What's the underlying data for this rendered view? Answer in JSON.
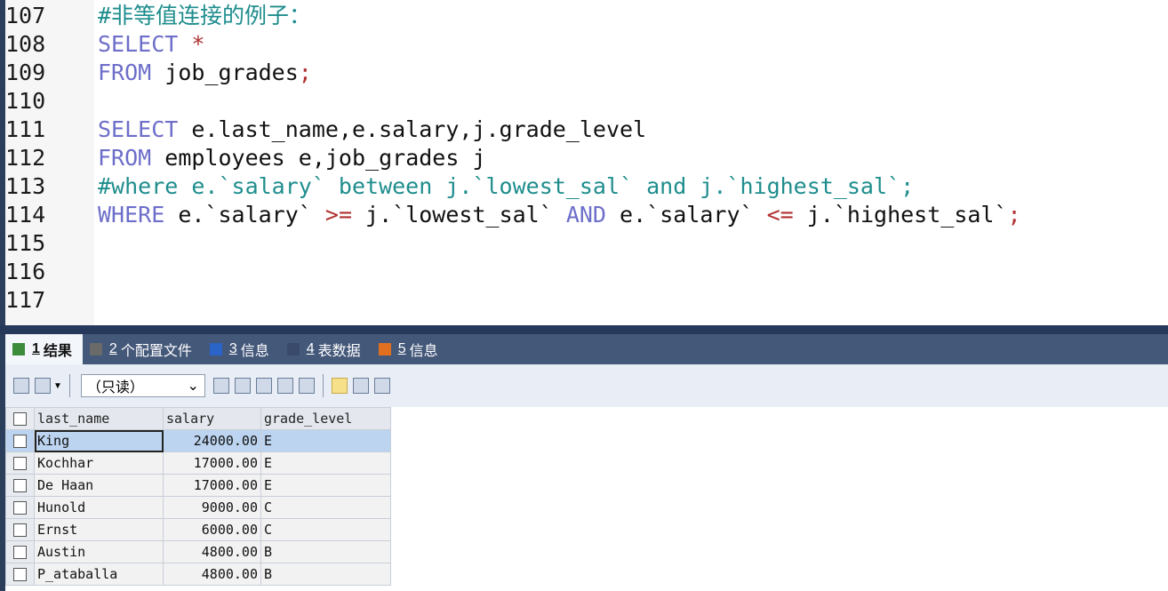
{
  "editor": {
    "lines": [
      {
        "num": "107",
        "parts": [
          {
            "t": "#非等值连接的例子：",
            "c": "cm"
          }
        ]
      },
      {
        "num": "108",
        "parts": [
          {
            "t": "SELECT ",
            "c": "kw"
          },
          {
            "t": "*",
            "c": "op"
          }
        ]
      },
      {
        "num": "109",
        "parts": [
          {
            "t": "FROM ",
            "c": "kw"
          },
          {
            "t": "job_grades",
            "c": "plain"
          },
          {
            "t": ";",
            "c": "op"
          }
        ]
      },
      {
        "num": "110",
        "parts": []
      },
      {
        "num": "111",
        "parts": [
          {
            "t": "SELECT ",
            "c": "kw"
          },
          {
            "t": "e.last_name,e.salary,j.grade_level",
            "c": "plain"
          }
        ]
      },
      {
        "num": "112",
        "parts": [
          {
            "t": "FROM ",
            "c": "kw"
          },
          {
            "t": "employees e,job_grades j",
            "c": "plain"
          }
        ]
      },
      {
        "num": "113",
        "parts": [
          {
            "t": "#where e.`salary` between j.`lowest_sal` and j.`highest_sal`;",
            "c": "cm"
          }
        ]
      },
      {
        "num": "114",
        "parts": [
          {
            "t": "WHERE ",
            "c": "kw"
          },
          {
            "t": "e.`salary` ",
            "c": "plain"
          },
          {
            "t": ">=",
            "c": "op"
          },
          {
            "t": " j.`lowest_sal` ",
            "c": "plain"
          },
          {
            "t": "AND",
            "c": "kw"
          },
          {
            "t": " e.`salary` ",
            "c": "plain"
          },
          {
            "t": "<=",
            "c": "op"
          },
          {
            "t": " j.`highest_sal`",
            "c": "plain"
          },
          {
            "t": ";",
            "c": "op"
          }
        ]
      },
      {
        "num": "115",
        "parts": []
      },
      {
        "num": "116",
        "parts": []
      },
      {
        "num": "117",
        "parts": []
      }
    ]
  },
  "tabs": [
    {
      "num": "1",
      "label": "结果",
      "icon": "result-grid-icon",
      "color": "#3c8c3c"
    },
    {
      "num": "2",
      "label": "个配置文件",
      "icon": "profile-icon",
      "color": "#6a6a6a"
    },
    {
      "num": "3",
      "label": "信息",
      "icon": "info-icon",
      "color": "#2a64c8"
    },
    {
      "num": "4",
      "label": "表数据",
      "icon": "table-data-icon",
      "color": "#3a4a6a"
    },
    {
      "num": "5",
      "label": "信息",
      "icon": "info-chart-icon",
      "color": "#e07020"
    }
  ],
  "toolbar": {
    "mode_select": "（只读）",
    "dropdown_arrow": "⌄"
  },
  "grid": {
    "columns": [
      "last_name",
      "salary",
      "grade_level"
    ],
    "rows": [
      {
        "last_name": "King",
        "salary": "24000.00",
        "grade_level": "E"
      },
      {
        "last_name": "Kochhar",
        "salary": "17000.00",
        "grade_level": "E"
      },
      {
        "last_name": "De Haan",
        "salary": "17000.00",
        "grade_level": "E"
      },
      {
        "last_name": "Hunold",
        "salary": "9000.00",
        "grade_level": "C"
      },
      {
        "last_name": "Ernst",
        "salary": "6000.00",
        "grade_level": "C"
      },
      {
        "last_name": "Austin",
        "salary": "4800.00",
        "grade_level": "B"
      },
      {
        "last_name": "P_ataballa",
        "salary": "4800.00",
        "grade_level": "B"
      }
    ]
  }
}
